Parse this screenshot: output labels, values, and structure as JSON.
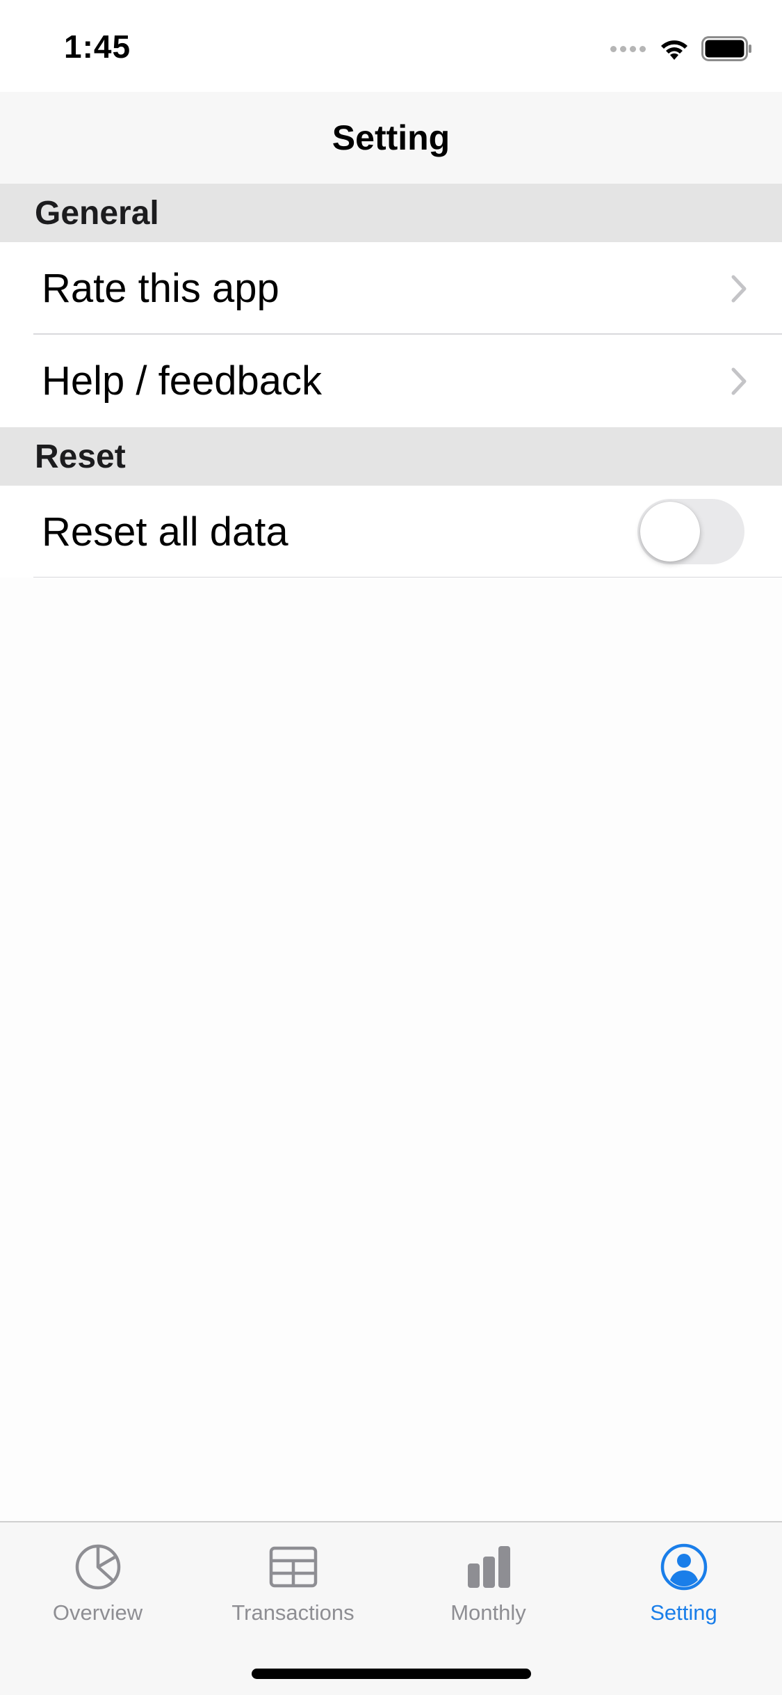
{
  "status_bar": {
    "time": "1:45",
    "signal_icon": "signal-dots-icon",
    "wifi_icon": "wifi-icon",
    "battery_icon": "battery-icon"
  },
  "nav": {
    "title": "Setting"
  },
  "sections": [
    {
      "header": "General",
      "rows": [
        {
          "label": "Rate this app",
          "accessory": "chevron-right-icon"
        },
        {
          "label": "Help / feedback",
          "accessory": "chevron-right-icon"
        }
      ]
    },
    {
      "header": "Reset",
      "rows": [
        {
          "label": "Reset all data",
          "accessory": "toggle",
          "toggle_on": false
        }
      ]
    }
  ],
  "tab_bar": {
    "items": [
      {
        "label": "Overview",
        "icon": "pie-chart-icon",
        "active": false
      },
      {
        "label": "Transactions",
        "icon": "table-icon",
        "active": false
      },
      {
        "label": "Monthly",
        "icon": "bar-chart-icon",
        "active": false
      },
      {
        "label": "Setting",
        "icon": "person-circle-icon",
        "active": true
      }
    ]
  },
  "colors": {
    "accent": "#1a7ee9",
    "inactive": "#8e8e93",
    "section_header_bg": "#e4e4e4",
    "nav_bg": "#f7f7f7"
  }
}
